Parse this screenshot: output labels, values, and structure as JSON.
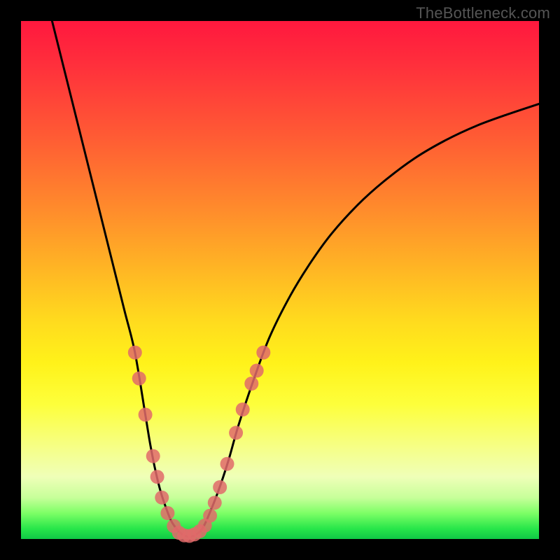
{
  "watermark": "TheBottleneck.com",
  "chart_data": {
    "type": "line",
    "title": "",
    "xlabel": "",
    "ylabel": "",
    "xlim": [
      0,
      100
    ],
    "ylim": [
      0,
      100
    ],
    "grid": false,
    "legend": false,
    "series": [
      {
        "name": "curve",
        "color": "#000000",
        "x": [
          6,
          8,
          10,
          12,
          14,
          16,
          18,
          20,
          22,
          24,
          25,
          26,
          27,
          28,
          29,
          30,
          31,
          32,
          33,
          34,
          35,
          36,
          38,
          40,
          42,
          45,
          48,
          52,
          56,
          60,
          65,
          70,
          76,
          82,
          88,
          94,
          100
        ],
        "y": [
          100,
          92,
          84,
          76,
          68,
          60,
          52,
          44,
          36,
          24,
          18,
          13,
          9,
          6,
          3.5,
          2,
          1,
          0.5,
          0.5,
          1,
          2,
          4,
          9,
          15,
          22,
          31,
          39,
          47,
          53.5,
          59,
          64.5,
          69,
          73.5,
          77,
          79.8,
          82,
          84
        ]
      }
    ],
    "markers": {
      "name": "highlighted-points",
      "color": "#e06a6a",
      "radius_pct": 1.35,
      "points": [
        {
          "x": 22.0,
          "y": 36.0
        },
        {
          "x": 22.8,
          "y": 31.0
        },
        {
          "x": 24.0,
          "y": 24.0
        },
        {
          "x": 25.5,
          "y": 16.0
        },
        {
          "x": 26.3,
          "y": 12.0
        },
        {
          "x": 27.2,
          "y": 8.0
        },
        {
          "x": 28.3,
          "y": 5.0
        },
        {
          "x": 29.5,
          "y": 2.5
        },
        {
          "x": 30.5,
          "y": 1.2
        },
        {
          "x": 31.5,
          "y": 0.7
        },
        {
          "x": 32.5,
          "y": 0.6
        },
        {
          "x": 33.5,
          "y": 0.9
        },
        {
          "x": 34.5,
          "y": 1.5
        },
        {
          "x": 35.5,
          "y": 2.6
        },
        {
          "x": 36.5,
          "y": 4.5
        },
        {
          "x": 37.4,
          "y": 7.0
        },
        {
          "x": 38.4,
          "y": 10.0
        },
        {
          "x": 39.8,
          "y": 14.5
        },
        {
          "x": 41.5,
          "y": 20.5
        },
        {
          "x": 42.8,
          "y": 25.0
        },
        {
          "x": 44.5,
          "y": 30.0
        },
        {
          "x": 45.5,
          "y": 32.5
        },
        {
          "x": 46.8,
          "y": 36.0
        }
      ]
    }
  }
}
